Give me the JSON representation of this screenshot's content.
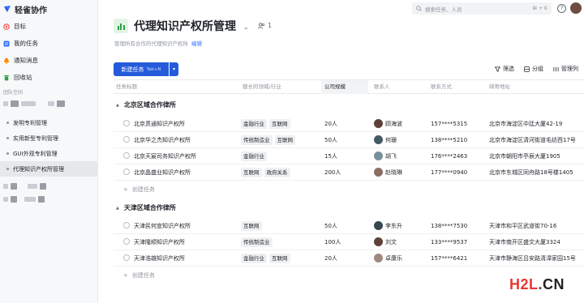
{
  "app": {
    "name": "轻雀协作"
  },
  "sidebar": {
    "nav": [
      {
        "label": "目标",
        "icon": "target-icon",
        "color": "#f54a45"
      },
      {
        "label": "我的任务",
        "icon": "task-icon",
        "color": "#3370ff"
      },
      {
        "label": "通知消息",
        "icon": "bell-icon",
        "color": "#ff8800"
      },
      {
        "label": "回收站",
        "icon": "trash-icon",
        "color": "#2ea043"
      }
    ],
    "workspace_label": "团队空间",
    "projects": [
      {
        "label": "发明专利管理"
      },
      {
        "label": "实用新型专利管理"
      },
      {
        "label": "GUI外观专利管理"
      },
      {
        "label": "代理知识产权所管理"
      }
    ]
  },
  "topbar": {
    "search_placeholder": "搜索任务、人员",
    "shortcut": "⌘ + K",
    "help": "?"
  },
  "header": {
    "title": "代理知识产权所管理",
    "members": "1",
    "subtitle": "管理所有合作的代理知识产权所",
    "edit": "编辑"
  },
  "toolbar": {
    "new_task": "新建任务",
    "new_task_shortcut": "Tab+N",
    "filter": "筛选",
    "group": "分组",
    "columns": "管理列"
  },
  "columns": [
    "任务标题",
    "擅长的领域/行业",
    "公司规模",
    "联系人",
    "联系方式",
    "邮寄地址"
  ],
  "groups": [
    {
      "title": "北京区域合作律所",
      "rows": [
        {
          "name": "北京贯通知识产权所",
          "tags": [
            "金融行业",
            "互联网"
          ],
          "size": "20人",
          "contact": "顾海波",
          "phone": "157****5315",
          "address": "北京市海淀区中廷大厦42-19"
        },
        {
          "name": "北京华之杰知识产权所",
          "tags": [
            "传统制造业",
            "互联网"
          ],
          "size": "50人",
          "contact": "何珊",
          "phone": "138****5210",
          "address": "北京市海淀区清河街道毛纺西17号"
        },
        {
          "name": "北京天宸司务知识产权所",
          "tags": [
            "金融行业"
          ],
          "size": "15人",
          "contact": "胡飞",
          "phone": "176****2463",
          "address": "北京市朝阳市亭辰大厦1905"
        },
        {
          "name": "北京晶盛业知识产权所",
          "tags": [
            "互联网",
            "政府关系"
          ],
          "size": "200人",
          "contact": "赵晓琳",
          "phone": "177****0940",
          "address": "北京市东城区同舟路18号楼1405"
        }
      ],
      "add_label": "创建任务"
    },
    {
      "title": "天津区域合作律所",
      "rows": [
        {
          "name": "天津民何宣知识产权所",
          "tags": [
            "互联网"
          ],
          "size": "50人",
          "contact": "李东升",
          "phone": "138****7530",
          "address": "天津市和平区武道街70-16"
        },
        {
          "name": "天津隆顺知识产权所",
          "tags": [
            "传统制造业"
          ],
          "size": "100人",
          "contact": "刘文",
          "phone": "133****9537",
          "address": "天津市南开区盛文大厦3324"
        },
        {
          "name": "天津浩雄知识产权所",
          "tags": [
            "金融行业",
            "互联网"
          ],
          "size": "20人",
          "contact": "卓康乐",
          "phone": "157****6421",
          "address": "天津市静海区吕安路清漳家园15号"
        }
      ],
      "add_label": "创建任务"
    }
  ],
  "watermark": {
    "h2l": "H2L",
    "dot": ".",
    "cn": "CN"
  }
}
